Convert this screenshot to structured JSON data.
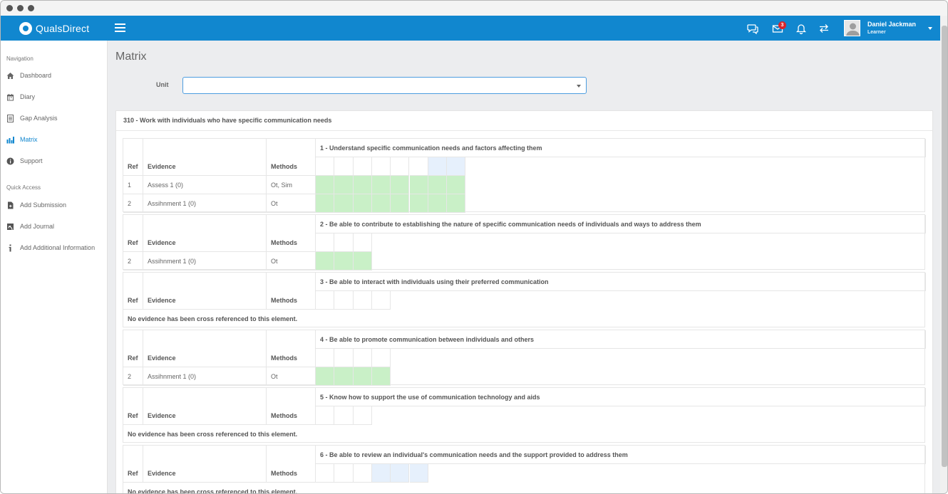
{
  "header": {
    "brand": "QualsDirect",
    "mail_badge": "3",
    "user_name": "Daniel Jackman",
    "user_role": "Learner"
  },
  "sidebar": {
    "nav_heading": "Navigation",
    "nav_items": [
      {
        "label": "Dashboard",
        "icon": "home-icon"
      },
      {
        "label": "Diary",
        "icon": "calendar-icon"
      },
      {
        "label": "Gap Analysis",
        "icon": "document-icon"
      },
      {
        "label": "Matrix",
        "icon": "bar-chart-icon",
        "active": true
      },
      {
        "label": "Support",
        "icon": "info-circle-icon"
      }
    ],
    "quick_heading": "Quick Access",
    "quick_items": [
      {
        "label": "Add Submission",
        "icon": "file-add-icon"
      },
      {
        "label": "Add Journal",
        "icon": "journal-icon"
      },
      {
        "label": "Add Additional Information",
        "icon": "info-icon"
      }
    ]
  },
  "page": {
    "title": "Matrix",
    "unit_label": "Unit",
    "unit_value": ""
  },
  "panel": {
    "title": "310 - Work with individuals who have specific communication needs",
    "col_ref": "Ref",
    "col_evidence": "Evidence",
    "col_methods": "Methods",
    "no_evidence": "No evidence has been cross referenced to this element.",
    "outcomes": [
      {
        "title": "1 - Understand specific communication needs and factors affecting them",
        "criteria_count": 8,
        "highlighted_header_cells": [
          6,
          7
        ],
        "rows": [
          {
            "ref": "1",
            "evidence": "Assess 1 (0)",
            "methods": "Ot, Sim",
            "filled_cells": 8
          },
          {
            "ref": "2",
            "evidence": "Assihnment 1 (0)",
            "methods": "Ot",
            "filled_cells": 8
          }
        ]
      },
      {
        "title": "2 - Be able to contribute to establishing the nature of specific communication needs of individuals and ways to address them",
        "criteria_count": 3,
        "highlighted_header_cells": [],
        "rows": [
          {
            "ref": "2",
            "evidence": "Assihnment 1 (0)",
            "methods": "Ot",
            "filled_cells": 3
          }
        ]
      },
      {
        "title": "3 - Be able to interact with individuals using their preferred communication",
        "criteria_count": 4,
        "highlighted_header_cells": [],
        "rows": []
      },
      {
        "title": "4 - Be able to promote communication between individuals and others",
        "criteria_count": 4,
        "highlighted_header_cells": [],
        "rows": [
          {
            "ref": "2",
            "evidence": "Assihnment 1 (0)",
            "methods": "Ot",
            "filled_cells": 4
          }
        ]
      },
      {
        "title": "5 - Know how to support the use of communication technology and aids",
        "criteria_count": 3,
        "highlighted_header_cells": [],
        "rows": []
      },
      {
        "title": "6 - Be able to review an individual's communication needs and the support provided to address them",
        "criteria_count": 6,
        "highlighted_header_cells": [
          3,
          4,
          5
        ],
        "rows": []
      }
    ]
  },
  "colors": {
    "topbar": "#1187cf",
    "evidence_green": "#c9f0c7",
    "header_blue": "#e6f0fc",
    "badge_red": "#d9252b"
  }
}
